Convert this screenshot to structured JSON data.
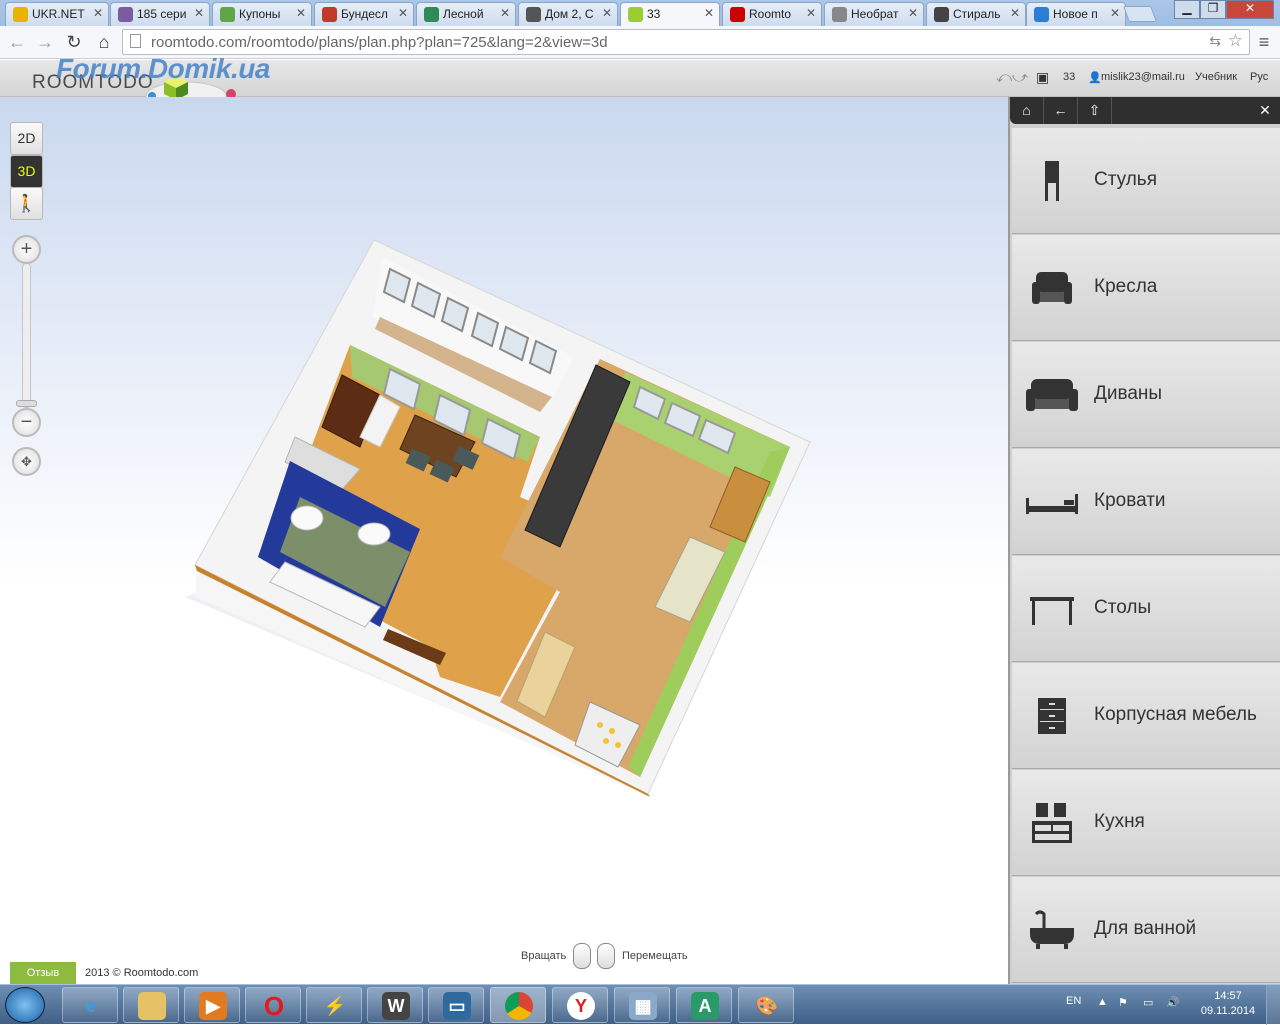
{
  "browser": {
    "tabs": [
      {
        "label": "UKR.NET",
        "color": "#e8b400"
      },
      {
        "label": "185 сери",
        "color": "#7b5c9e"
      },
      {
        "label": "Купоны",
        "color": "#5ea648"
      },
      {
        "label": "Бундесл",
        "color": "#c0392b"
      },
      {
        "label": "Лесной",
        "color": "#2e8b57"
      },
      {
        "label": "Дом 2, С",
        "color": "#555555"
      },
      {
        "label": "33",
        "color": "#9acd32"
      },
      {
        "label": "Roomto",
        "color": "#cc0000"
      },
      {
        "label": "Необрат",
        "color": "#888888"
      },
      {
        "label": "Стираль",
        "color": "#444444"
      },
      {
        "label": "Новое п",
        "color": "#2a7fd4"
      }
    ],
    "url_host": "roomtodo.com",
    "url_path": "/roomtodo/plans/plan.php?plan=725&lang=2&view=3d"
  },
  "header": {
    "logo": "ROOMTODO",
    "watermark": "Forum.Domik.ua",
    "plan_number": "33",
    "user_email": "mislik23@mail.ru",
    "tutorial": "Учебник",
    "language": "Рус"
  },
  "view_tools": {
    "btn_2d": "2D",
    "btn_3d": "3D",
    "zoom_in": "+",
    "zoom_out": "−"
  },
  "footer": {
    "feedback": "Отзыв",
    "copyright": "2013 © Roomtodo.com",
    "rotate_hint": "Вращать",
    "move_hint": "Перемещать"
  },
  "catalog": {
    "categories": [
      {
        "label": "Стулья",
        "icon": "chair-icon"
      },
      {
        "label": "Кресла",
        "icon": "armchair-icon"
      },
      {
        "label": "Диваны",
        "icon": "sofa-icon"
      },
      {
        "label": "Кровати",
        "icon": "bed-icon"
      },
      {
        "label": "Столы",
        "icon": "table-icon"
      },
      {
        "label": "Корпусная мебель",
        "icon": "cabinet-icon"
      },
      {
        "label": "Кухня",
        "icon": "kitchen-icon"
      },
      {
        "label": "Для ванной",
        "icon": "bathtub-icon"
      }
    ]
  },
  "taskbar": {
    "lang": "EN",
    "time": "14:57",
    "date": "09.11.2014"
  }
}
